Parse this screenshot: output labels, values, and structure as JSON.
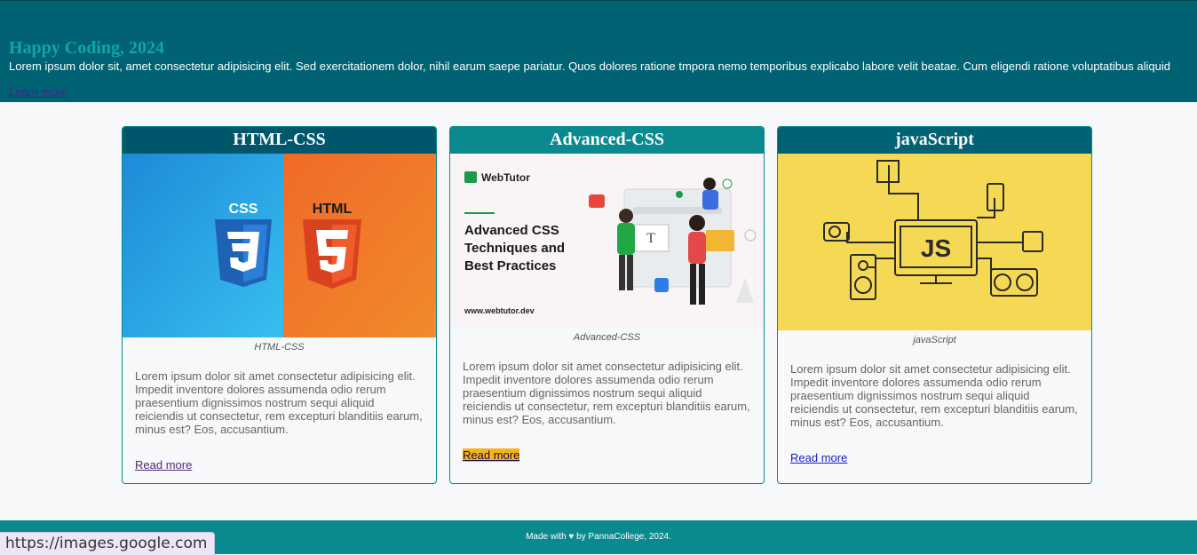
{
  "header": {
    "title": "Happy Coding, 2024",
    "description": "Lorem ipsum dolor sit, amet consectetur adipisicing elit. Sed exercitationem dolor, nihil earum saepe pariatur. Quos dolores ratione tmpora nemo temporibus explicabo labore velit beatae. Cum eligendi ratione voluptatibus aliquid",
    "link": "Learn more"
  },
  "cards": [
    {
      "title": "HTML-CSS",
      "badge_left": "CSS",
      "badge_right": "HTML",
      "caption": "HTML-CSS",
      "body": "Lorem ipsum dolor sit amet consectetur adipisicing elit. Impedit inventore dolores assumenda odio rerum praesentium dignissimos nostrum sequi aliquid reiciendis ut consectetur, rem excepturi blanditiis earum, minus est? Eos, accusantium.",
      "link": "Read more"
    },
    {
      "title": "Advanced-CSS",
      "brand": "WebTutor",
      "headline_1": "Advanced CSS",
      "headline_2": "Techniques and",
      "headline_3": "Best Practices",
      "site": "www.webtutor.dev",
      "caption": "Advanced-CSS",
      "body": "Lorem ipsum dolor sit amet consectetur adipisicing elit. Impedit inventore dolores assumenda odio rerum praesentium dignissimos nostrum sequi aliquid reiciendis ut consectetur, rem excepturi blanditiis earum, minus est? Eos, accusantium.",
      "link": "Read more"
    },
    {
      "title": "javaScript",
      "chip_label": "JS",
      "caption": "javaScript",
      "body": "Lorem ipsum dolor sit amet consectetur adipisicing elit. Impedit inventore dolores assumenda odio rerum praesentium dignissimos nostrum sequi aliquid reiciendis ut consectetur, rem excepturi blanditiis earum, minus est? Eos, accusantium.",
      "link": "Read more"
    }
  ],
  "footer": {
    "text": "Made with ♥ by PannaCollege, 2024."
  },
  "status_url": "https://images.google.com"
}
